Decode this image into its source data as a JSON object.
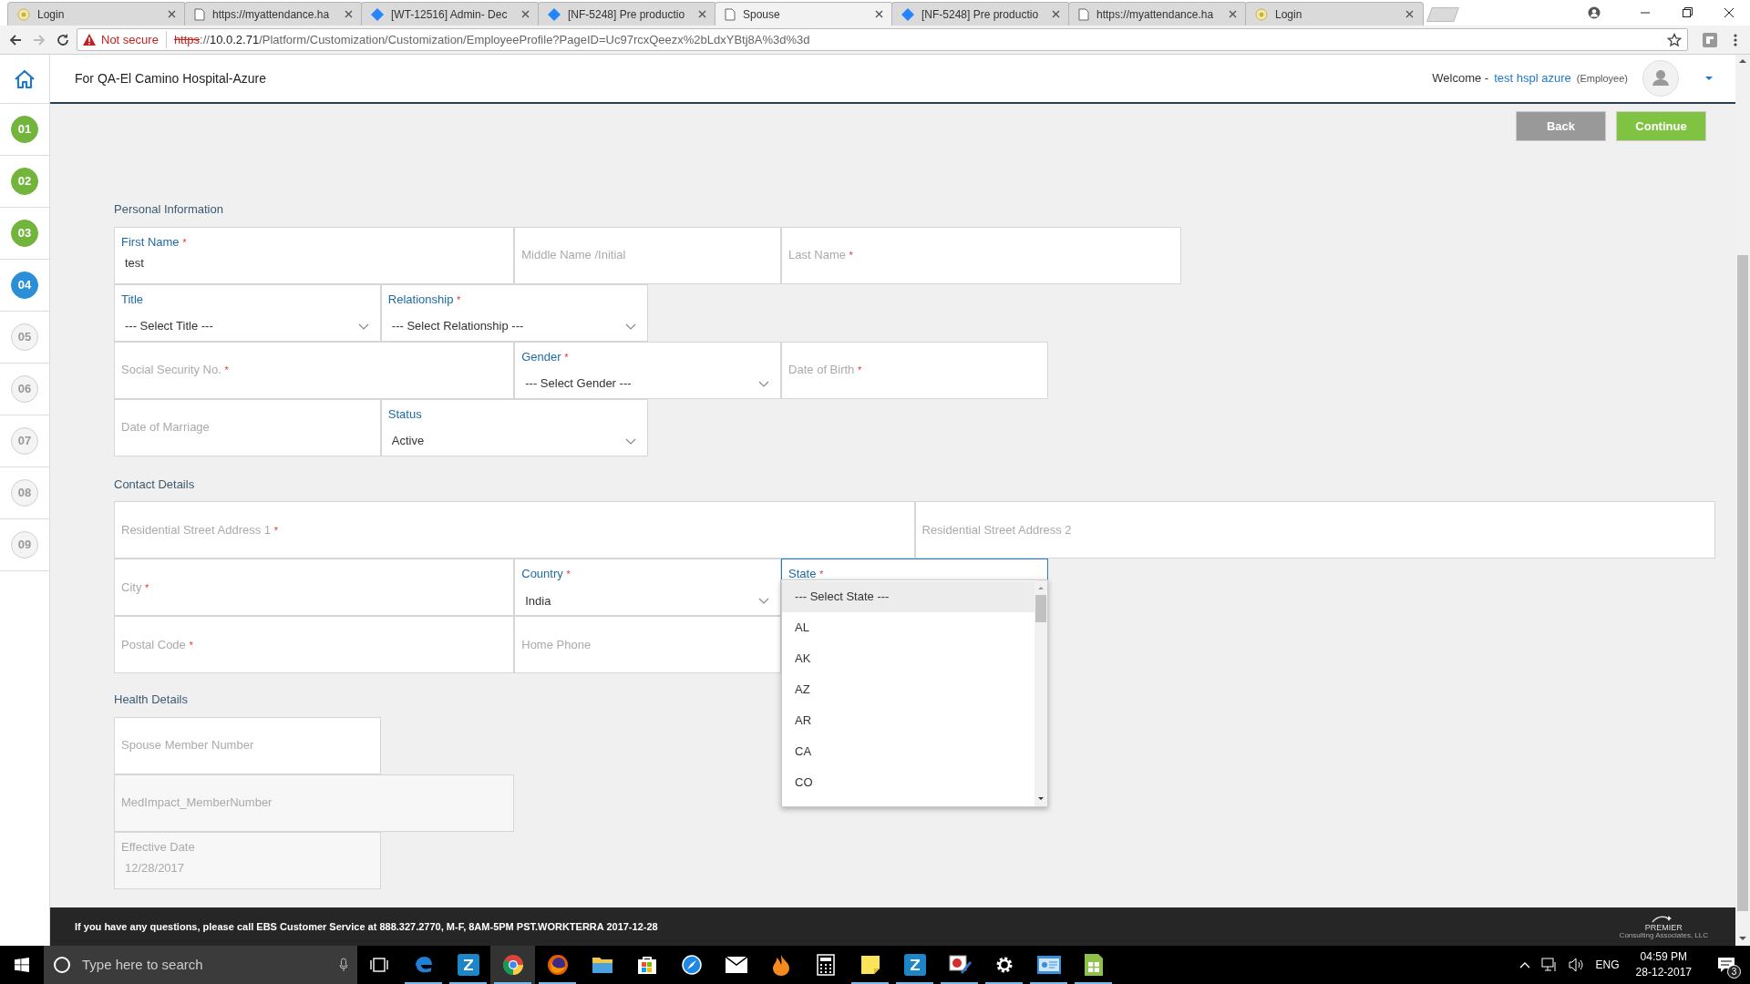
{
  "browser": {
    "tabs": [
      {
        "label": "Login",
        "kind": "login",
        "selected": false
      },
      {
        "label": "https://myattendance.ha",
        "kind": "page",
        "selected": false
      },
      {
        "label": "[WT-12516] Admin- Dec",
        "kind": "issue",
        "selected": false
      },
      {
        "label": "[NF-5248] Pre productio",
        "kind": "issue",
        "selected": false
      },
      {
        "label": "Spouse",
        "kind": "page",
        "selected": true
      },
      {
        "label": "[NF-5248] Pre productio",
        "kind": "issue",
        "selected": false
      },
      {
        "label": "https://myattendance.ha",
        "kind": "page",
        "selected": false
      },
      {
        "label": "Login",
        "kind": "login",
        "selected": false
      }
    ],
    "security": "Not secure",
    "url": [
      {
        "text": "https",
        "kind": "scheme"
      },
      {
        "text": "://",
        "kind": "plain"
      },
      {
        "text": "10.0.2.71",
        "kind": "host"
      },
      {
        "text": "/Platform/Customization/Customization/EmployeeProfile?PageID=Uc97rcxQeezx%2bLdxYBtj8A%3d%3d",
        "kind": "plain"
      }
    ]
  },
  "header": {
    "title": "For QA-El Camino Hospital-Azure",
    "welcome": "Welcome -",
    "user": "test hspl azure",
    "role": "(Employee)"
  },
  "steps": [
    {
      "label": "01",
      "completed": true,
      "selected": false
    },
    {
      "label": "02",
      "completed": true,
      "selected": false
    },
    {
      "label": "03",
      "completed": true,
      "selected": false
    },
    {
      "label": "04",
      "completed": false,
      "selected": true
    },
    {
      "label": "05",
      "completed": false,
      "selected": false
    },
    {
      "label": "06",
      "completed": false,
      "selected": false
    },
    {
      "label": "07",
      "completed": false,
      "selected": false
    },
    {
      "label": "08",
      "completed": false,
      "selected": false
    },
    {
      "label": "09",
      "completed": false,
      "selected": false
    }
  ],
  "buttons": [
    {
      "label": "Back",
      "kind": "secondary"
    },
    {
      "label": "Continue",
      "kind": "primary"
    }
  ],
  "sections": [
    {
      "title": "Personal Information",
      "rows": [
        [
          {
            "label": "First Name",
            "required_mark": "*",
            "kind": "text",
            "value": "test"
          },
          {
            "label": "Middle Name /Initial",
            "kind": "text"
          },
          {
            "label": "Last Name",
            "required_mark": "*",
            "kind": "text"
          }
        ],
        [
          {
            "label": "Title",
            "kind": "select",
            "value": "--- Select Title ---"
          },
          {
            "label": "Relationship",
            "required_mark": "*",
            "kind": "select",
            "value": "--- Select Relationship ---"
          }
        ],
        [
          {
            "label": "Social Security No.",
            "required_mark": "*",
            "kind": "text"
          },
          {
            "label": "Gender",
            "required_mark": "*",
            "kind": "select",
            "value": "--- Select Gender ---"
          },
          {
            "label": "Date of Birth",
            "required_mark": "*",
            "kind": "text"
          }
        ],
        [
          {
            "label": "Date of Marriage",
            "kind": "text"
          },
          {
            "label": "Status",
            "kind": "select",
            "value": "Active"
          }
        ]
      ]
    },
    {
      "title": "Contact Details",
      "rows": [
        [
          {
            "label": "Residential Street Address 1",
            "required_mark": "*",
            "kind": "text"
          },
          {
            "label": "Residential Street Address 2",
            "kind": "text"
          }
        ],
        [
          {
            "label": "City",
            "required_mark": "*",
            "kind": "text"
          },
          {
            "label": "Country",
            "required_mark": "*",
            "kind": "select",
            "value": "India"
          },
          {
            "label": "State",
            "required_mark": "*",
            "kind": "select",
            "expanded": true,
            "options": [
              {
                "label": "--- Select State ---",
                "selected": true
              },
              {
                "label": "AL",
                "selected": false
              },
              {
                "label": "AK",
                "selected": false
              },
              {
                "label": "AZ",
                "selected": false
              },
              {
                "label": "AR",
                "selected": false
              },
              {
                "label": "CA",
                "selected": false
              },
              {
                "label": "CO",
                "selected": false
              }
            ]
          }
        ],
        [
          {
            "label": "Postal Code",
            "required_mark": "*",
            "kind": "text"
          },
          {
            "label": "Home Phone",
            "kind": "text"
          }
        ]
      ]
    },
    {
      "title": "Health Details",
      "rows": [
        [
          {
            "label": "Spouse Member Number",
            "kind": "text"
          }
        ],
        [
          {
            "label": "MedImpact_MemberNumber",
            "kind": "text",
            "disabled": true
          }
        ],
        [
          {
            "label": "Effective Date",
            "kind": "text",
            "value": "12/28/2017",
            "disabled": true
          }
        ]
      ]
    }
  ],
  "footer": {
    "text": "If you have any questions, please call EBS Customer Service at 888.327.2770, M-F, 8AM-5PM PST.WORKTERRA 2017-12-28",
    "logo_name": "PREMIER",
    "logo_tagline": "Consulting Associates, LLC"
  },
  "taskbar": {
    "search_placeholder": "Type here to search",
    "apps": [
      {
        "kind": "edge",
        "running": true,
        "selected": false
      },
      {
        "kind": "z",
        "running": true,
        "selected": false
      },
      {
        "kind": "chrome",
        "running": true,
        "selected": true
      },
      {
        "kind": "firefox",
        "running": true,
        "selected": false
      },
      {
        "kind": "folder",
        "running": false,
        "selected": false
      },
      {
        "kind": "store",
        "running": false,
        "selected": false
      },
      {
        "kind": "compass",
        "running": false,
        "selected": false
      },
      {
        "kind": "mail",
        "running": false,
        "selected": false
      },
      {
        "kind": "flame",
        "running": false,
        "selected": false
      },
      {
        "kind": "calculator",
        "running": false,
        "selected": false
      },
      {
        "kind": "note",
        "running": true,
        "selected": false
      },
      {
        "kind": "z",
        "running": true,
        "selected": false
      },
      {
        "kind": "tool",
        "running": true,
        "selected": false
      },
      {
        "kind": "gear",
        "running": true,
        "selected": false
      },
      {
        "kind": "card",
        "running": true,
        "selected": false
      },
      {
        "kind": "sheet",
        "running": true,
        "selected": false
      }
    ],
    "language": "ENG",
    "time": "04:59 PM",
    "date": "28-12-2017",
    "notifications": "3"
  }
}
